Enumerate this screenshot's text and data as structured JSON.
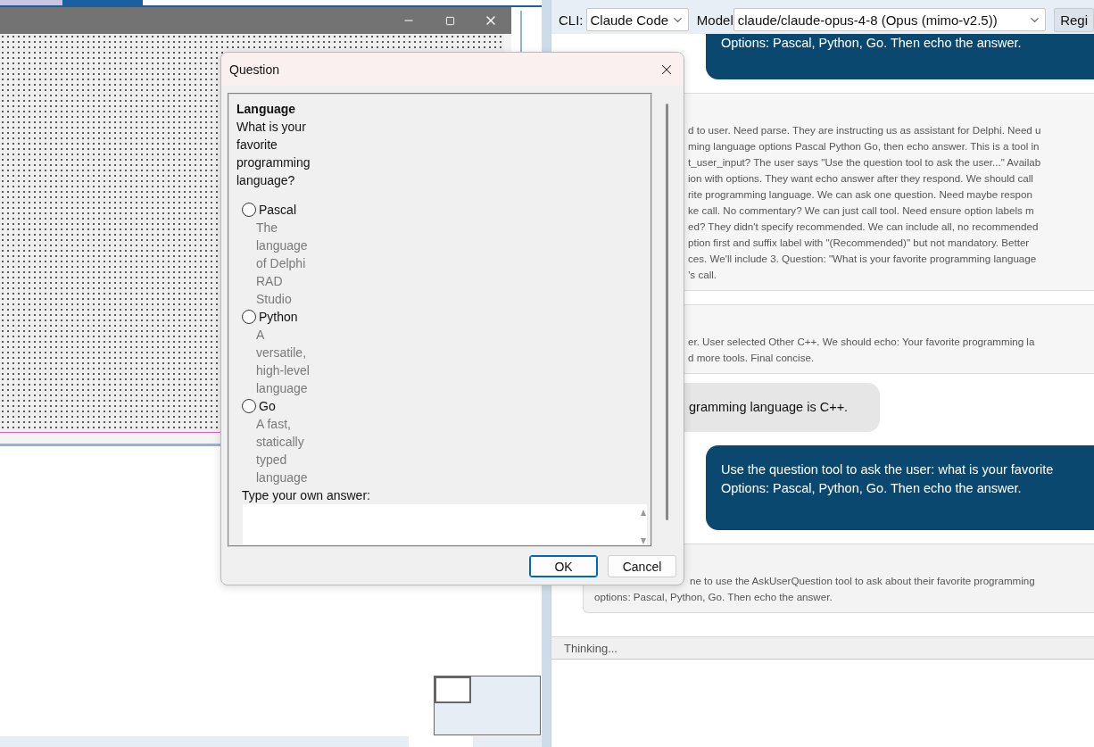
{
  "chat_toolbar": {
    "cli_label": "CLI:",
    "cli_value": "Claude Code",
    "model_label": "Model",
    "model_value": "claude/claude-opus-4-8 (Opus (mimo-v2.5))",
    "register_button": "Regi"
  },
  "messages": [
    {
      "kind": "user",
      "lines": [
        "Options: Pascal, Python, Go. Then echo the answer."
      ]
    },
    {
      "kind": "reasoning",
      "lines": [
        "d to user. Need parse. They are instructing us as assistant for Delphi. Need u",
        "ming language options Pascal Python Go, then echo answer. This is a tool in",
        "t_user_input? The user says \"Use the question tool to ask the user...\" Availab",
        "ion with options. They want echo answer after they respond. We should call",
        "rite programming language. We can ask one question. Need maybe respon",
        "ke call. No commentary? We can just call tool. Need ensure option labels m",
        "ed? They didn't specify recommended. We can include all, no recommended",
        "ption first and suffix label with \"(Recommended)\" but not mandatory. Better",
        "ces. We'll include 3. Question: \"What is your favorite programming language",
        "’s call."
      ]
    },
    {
      "kind": "reasoning",
      "lines": [
        "er. User selected Other C++. We should echo: Your favorite programming la",
        "d more tools. Final concise."
      ]
    },
    {
      "kind": "assistant",
      "lines": [
        "gramming language is C++."
      ]
    },
    {
      "kind": "user",
      "lines": [
        "Use the question tool to ask the user: what is your favorite",
        "Options: Pascal, Python, Go. Then echo the answer."
      ]
    },
    {
      "kind": "request",
      "lines": [
        "ne to use the AskUserQuestion tool to ask about their favorite programming",
        "options: Pascal, Python, Go. Then echo the answer."
      ]
    }
  ],
  "status": "Thinking...",
  "dialog": {
    "title": "Question",
    "header": "Language",
    "question": "What is your favorite programming language?",
    "options": [
      {
        "label": "Pascal",
        "description": "The language of Delphi RAD Studio",
        "selected": false
      },
      {
        "label": "Python",
        "description": "A versatile, high-level language",
        "selected": false
      },
      {
        "label": "Go",
        "description": "A fast, statically typed language",
        "selected": false
      }
    ],
    "own_answer_label": "Type your own answer:",
    "buttons": [
      {
        "label": "OK",
        "default": true
      },
      {
        "label": "Cancel",
        "default": false
      }
    ]
  }
}
